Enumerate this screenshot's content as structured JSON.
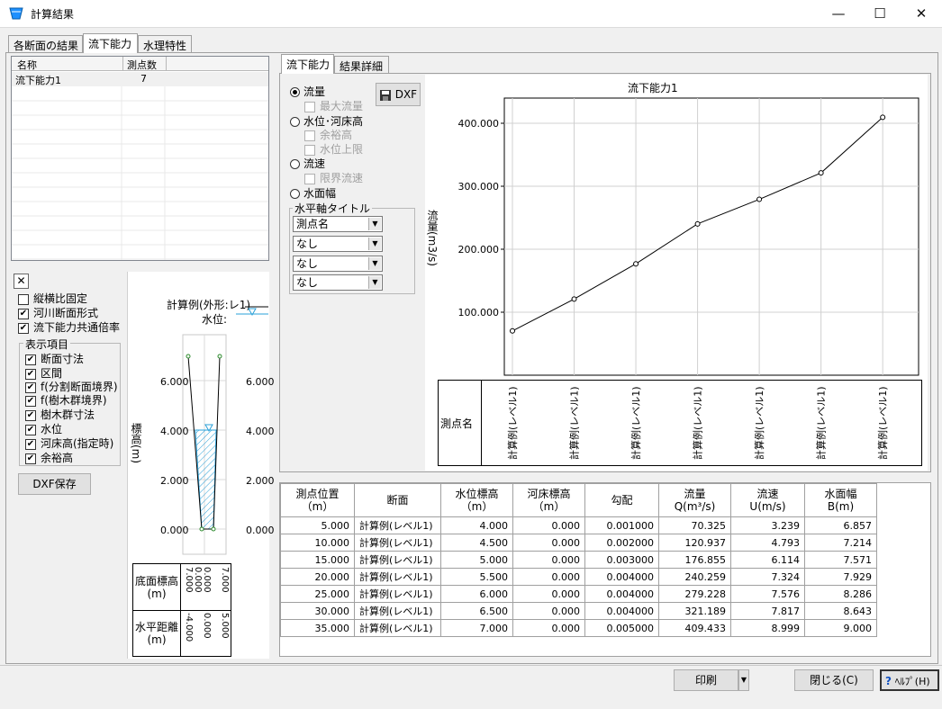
{
  "window": {
    "title": "計算結果",
    "minimize": "—",
    "maximize": "☐",
    "close": "✕"
  },
  "tabs": [
    "各断面の結果",
    "流下能力",
    "水理特性"
  ],
  "list": {
    "headers": [
      "名称",
      "測点数"
    ],
    "rows": [
      {
        "name": "流下能力1",
        "count": "7"
      }
    ]
  },
  "options": {
    "close": "✕",
    "aspect": "縦横比固定",
    "river_section": "河川断面形式",
    "common_scale": "流下能力共通倍率"
  },
  "display": {
    "title": "表示項目",
    "items": [
      "断面寸法",
      "区間",
      "f(分割断面境界)",
      "f(樹木群境界)",
      "樹木群寸法",
      "水位",
      "河床高(指定時)",
      "余裕高"
    ]
  },
  "dxf_save": "DXF保存",
  "section": {
    "legend1": "計算例(外形:レ1)",
    "legend2": "水位:",
    "ylabel": "標高(m)",
    "yticks": [
      "6.000",
      "4.000",
      "2.000",
      "0.000"
    ],
    "row1": "底面標高\n(m)",
    "row2": "水平距離\n(m)",
    "bed": [
      "7.000",
      "0.000",
      "0.000",
      "7.000"
    ],
    "dist": [
      "-4.000",
      "0.000",
      "5.000"
    ]
  },
  "subtabs": [
    "流下能力",
    "結果詳細"
  ],
  "graph_opts": {
    "flow": "流量",
    "max_flow": "最大流量",
    "wl": "水位･河床高",
    "freeboard": "余裕高",
    "wl_limit": "水位上限",
    "velocity": "流速",
    "limit_vel": "限界流速",
    "width": "水面幅",
    "dxf": "DXF",
    "axis_title": "水平軸タイトル",
    "selects": [
      "測点名",
      "なし",
      "なし",
      "なし"
    ]
  },
  "chart_data": {
    "type": "line",
    "title": "流下能力1",
    "ylabel": "流量(m3/s)",
    "xlabel": "測点名",
    "ylim": [
      0,
      440
    ],
    "yticks": [
      "100.000",
      "200.000",
      "300.000",
      "400.000"
    ],
    "categories": [
      "計算例(レベル1)",
      "計算例(レベル1)",
      "計算例(レベル1)",
      "計算例(レベル1)",
      "計算例(レベル1)",
      "計算例(レベル1)",
      "計算例(レベル1)"
    ],
    "series": [
      {
        "values": [
          70.325,
          120.937,
          176.855,
          240.259,
          279.228,
          321.189,
          409.433
        ]
      }
    ],
    "grid": true
  },
  "table": {
    "headers": [
      "測点位置\n（m）",
      "断面",
      "水位標高\n（m）",
      "河床標高\n（m）",
      "勾配",
      "流量\nQ(m³/s)",
      "流速\nU(m/s)",
      "水面幅\nB(m)"
    ],
    "rows": [
      [
        "5.000",
        "計算例(レベル1)",
        "4.000",
        "0.000",
        "0.001000",
        "70.325",
        "3.239",
        "6.857"
      ],
      [
        "10.000",
        "計算例(レベル1)",
        "4.500",
        "0.000",
        "0.002000",
        "120.937",
        "4.793",
        "7.214"
      ],
      [
        "15.000",
        "計算例(レベル1)",
        "5.000",
        "0.000",
        "0.003000",
        "176.855",
        "6.114",
        "7.571"
      ],
      [
        "20.000",
        "計算例(レベル1)",
        "5.500",
        "0.000",
        "0.004000",
        "240.259",
        "7.324",
        "7.929"
      ],
      [
        "25.000",
        "計算例(レベル1)",
        "6.000",
        "0.000",
        "0.004000",
        "279.228",
        "7.576",
        "8.286"
      ],
      [
        "30.000",
        "計算例(レベル1)",
        "6.500",
        "0.000",
        "0.004000",
        "321.189",
        "7.817",
        "8.643"
      ],
      [
        "35.000",
        "計算例(レベル1)",
        "7.000",
        "0.000",
        "0.005000",
        "409.433",
        "8.999",
        "9.000"
      ]
    ]
  },
  "footer": {
    "print": "印刷",
    "close": "閉じる(C)",
    "help": "ﾍﾙﾌﾟ(H)"
  }
}
